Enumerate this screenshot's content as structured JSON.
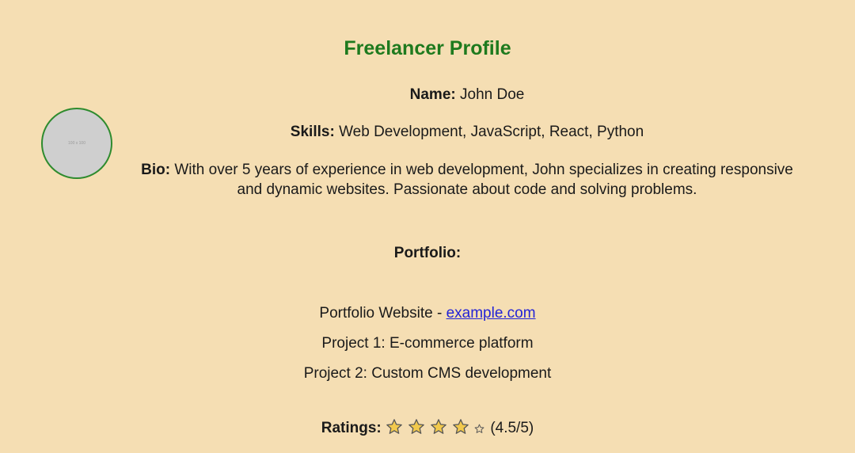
{
  "page": {
    "title": "Freelancer Profile"
  },
  "profile": {
    "avatar_placeholder": "100 x 100",
    "name_label": "Name:",
    "name_value": "John Doe",
    "skills_label": "Skills:",
    "skills_value": "Web Development, JavaScript, React, Python",
    "bio_label": "Bio:",
    "bio_value": "With over 5 years of experience in web development, John specializes in creating responsive and dynamic websites. Passionate about code and solving problems."
  },
  "portfolio": {
    "heading": "Portfolio:",
    "website_prefix": "Portfolio Website - ",
    "website_link": "example.com",
    "items": [
      "Project 1: E-commerce platform",
      "Project 2: Custom CMS development"
    ]
  },
  "ratings": {
    "label": "Ratings:",
    "filled_stars": 4,
    "total_stars": 5,
    "score_text": "(4.5/5)",
    "star_color": "#f2c94c",
    "star_outline": "#555555"
  },
  "colors": {
    "background": "#f5deb3",
    "title": "#1e7a1e",
    "avatar_border": "#2e8b2e",
    "link": "#2323d6"
  }
}
